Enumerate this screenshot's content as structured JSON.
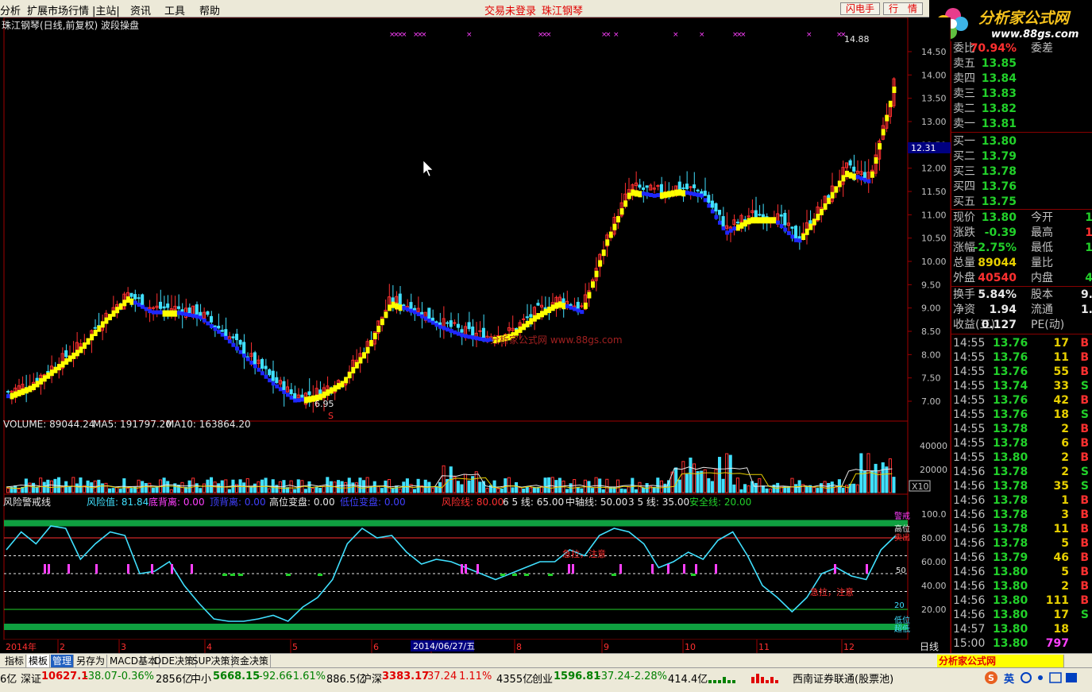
{
  "menu": {
    "items": [
      "分析",
      "扩展市场行情",
      "|主站|",
      "资讯",
      "工具",
      "帮助"
    ],
    "trade": "交易未登录",
    "stock": "珠江钢琴",
    "flash": "闪电手",
    "hq": "行　情"
  },
  "logo": {
    "title": "分析家公式网",
    "url": "www.88gs.com"
  },
  "chart": {
    "title": "珠江钢琴(日线,前复权) 波段操盘",
    "high_label": "14.88",
    "low_label": "6.95",
    "s_mark": "S",
    "crosshair_price": "12.31",
    "watermark": "分析家公式网 www.88gs.com",
    "date_marker": "2014/06/27/五",
    "year_label": "2014年",
    "month_labels": [
      "2",
      "3",
      "4",
      "5",
      "6",
      "7",
      "8",
      "9",
      "10",
      "11",
      "12"
    ],
    "period": "日线",
    "price_ticks": [
      "14.50",
      "14.00",
      "13.50",
      "13.00",
      "12.50",
      "12.00",
      "11.50",
      "11.00",
      "10.50",
      "10.00",
      "9.50",
      "9.00",
      "8.50",
      "8.00",
      "7.50",
      "7.00"
    ]
  },
  "volume": {
    "label": "VOLUME: 89044.24",
    "ma5": "MA5: 191797.20",
    "ma10": "MA10: 163864.20",
    "ticks": [
      "40000",
      "20000"
    ],
    "unit": "X10"
  },
  "risk": {
    "name": "风险警戒线",
    "fxz": "风险值: 81.84",
    "dbl": "底背离: 0.00",
    "dbl2": "顶背离: 0.00",
    "gwbp": "高位变盘: 0.00",
    "dwbp": "低位变盘: 0.00",
    "fxx": "风险线: 80.00",
    "x65": "6 5 线: 65.00",
    "zzx": "中轴线: 50.00",
    "x35": "3 5 线: 35.00",
    "aqx": "安全线: 20.00",
    "ticks": [
      "100.0",
      "80.00",
      "60.00",
      "40.00",
      "20.00"
    ],
    "mid": "50",
    "notes": [
      "急拉，注意",
      "急拉，注意"
    ],
    "side": [
      "警戒",
      "高位",
      "卖出",
      "20",
      "低位",
      "超低"
    ]
  },
  "chart_data": {
    "type": "line",
    "close_estimates": [
      7.2,
      7.4,
      7.8,
      8.2,
      8.8,
      9.3,
      9.0,
      9.0,
      8.9,
      8.5,
      8.0,
      7.5,
      7.1,
      7.2,
      7.5,
      8.2,
      9.2,
      9.0,
      8.7,
      8.5,
      8.4,
      8.5,
      8.9,
      9.2,
      9.0,
      10.5,
      11.6,
      11.5,
      11.6,
      11.5,
      10.7,
      11.0,
      11.0,
      10.5,
      11.2,
      12.0,
      11.8,
      13.8
    ]
  },
  "quote": {
    "ratio": {
      "label": "委比",
      "value": "70.94%",
      "label2": "委差",
      "value2": ""
    },
    "asks": [
      {
        "label": "卖五",
        "price": "13.85",
        "vol": ""
      },
      {
        "label": "卖四",
        "price": "13.84",
        "vol": ""
      },
      {
        "label": "卖三",
        "price": "13.83",
        "vol": ""
      },
      {
        "label": "卖二",
        "price": "13.82",
        "vol": ""
      },
      {
        "label": "卖一",
        "price": "13.81",
        "vol": ""
      }
    ],
    "bids": [
      {
        "label": "买一",
        "price": "13.80",
        "vol": ""
      },
      {
        "label": "买二",
        "price": "13.79",
        "vol": ""
      },
      {
        "label": "买三",
        "price": "13.78",
        "vol": ""
      },
      {
        "label": "买四",
        "price": "13.76",
        "vol": ""
      },
      {
        "label": "买五",
        "price": "13.75",
        "vol": ""
      }
    ],
    "info": [
      {
        "l1": "现价",
        "v1": "13.80",
        "c1": "#22d02a",
        "l2": "今开",
        "v2": "1",
        "c2": "#22d02a"
      },
      {
        "l1": "涨跌",
        "v1": "-0.39",
        "c1": "#22d02a",
        "l2": "最高",
        "v2": "1",
        "c2": "#ff3030"
      },
      {
        "l1": "涨幅",
        "v1": "-2.75%",
        "c1": "#22d02a",
        "l2": "最低",
        "v2": "1",
        "c2": "#22d02a"
      },
      {
        "l1": "总量",
        "v1": "89044",
        "c1": "#e8d000",
        "l2": "量比",
        "v2": "",
        "c2": "#e8d000"
      },
      {
        "l1": "外盘",
        "v1": "40540",
        "c1": "#ff3030",
        "l2": "内盘",
        "v2": "4",
        "c2": "#22d02a"
      },
      {
        "l1": "换手",
        "v1": "5.84%",
        "c1": "#e8e8e8",
        "l2": "股本",
        "v2": "9.",
        "c2": "#e8e8e8"
      },
      {
        "l1": "净资",
        "v1": "1.94",
        "c1": "#e8e8e8",
        "l2": "流通",
        "v2": "1.",
        "c2": "#e8e8e8"
      },
      {
        "l1": "收益(三)",
        "v1": "0.127",
        "c1": "#e8e8e8",
        "l2": "PE(动)",
        "v2": "",
        "c2": "#e8e8e8"
      }
    ],
    "ticks": [
      {
        "t": "14:55",
        "p": "13.76",
        "v": "17",
        "b": "B"
      },
      {
        "t": "14:55",
        "p": "13.76",
        "v": "11",
        "b": "B"
      },
      {
        "t": "14:55",
        "p": "13.76",
        "v": "55",
        "b": "B"
      },
      {
        "t": "14:55",
        "p": "13.74",
        "v": "33",
        "b": "S"
      },
      {
        "t": "14:55",
        "p": "13.76",
        "v": "42",
        "b": "B"
      },
      {
        "t": "14:55",
        "p": "13.76",
        "v": "18",
        "b": "S"
      },
      {
        "t": "14:55",
        "p": "13.78",
        "v": "2",
        "b": "B"
      },
      {
        "t": "14:55",
        "p": "13.78",
        "v": "6",
        "b": "B"
      },
      {
        "t": "14:55",
        "p": "13.80",
        "v": "2",
        "b": "B"
      },
      {
        "t": "14:56",
        "p": "13.78",
        "v": "2",
        "b": "S"
      },
      {
        "t": "14:56",
        "p": "13.78",
        "v": "35",
        "b": "S"
      },
      {
        "t": "14:56",
        "p": "13.78",
        "v": "1",
        "b": "B"
      },
      {
        "t": "14:56",
        "p": "13.78",
        "v": "3",
        "b": "B"
      },
      {
        "t": "14:56",
        "p": "13.78",
        "v": "11",
        "b": "B"
      },
      {
        "t": "14:56",
        "p": "13.78",
        "v": "5",
        "b": "B"
      },
      {
        "t": "14:56",
        "p": "13.79",
        "v": "46",
        "b": "B"
      },
      {
        "t": "14:56",
        "p": "13.80",
        "v": "5",
        "b": "B"
      },
      {
        "t": "14:56",
        "p": "13.80",
        "v": "2",
        "b": "B"
      },
      {
        "t": "14:56",
        "p": "13.80",
        "v": "111",
        "b": "B"
      },
      {
        "t": "14:56",
        "p": "13.80",
        "v": "17",
        "b": "S"
      },
      {
        "t": "14:57",
        "p": "13.80",
        "v": "18",
        "b": ""
      },
      {
        "t": "15:00",
        "p": "13.80",
        "v": "797",
        "b": ""
      }
    ]
  },
  "tabs": [
    "指标",
    "模板",
    "管理",
    "另存为",
    "MACD基本",
    "DDE决策",
    "SUP决策",
    "资金决策"
  ],
  "status": {
    "s0": "6亿",
    "sz": "深证",
    "szv": "10627.1",
    "szc": "-38.07",
    "szp": "-0.36%",
    "sza": "2856亿",
    "zx": "中小",
    "zxv": "5668.15",
    "zxc": "-92.66",
    "zxp": "-1.61%",
    "zxa": "886.5亿",
    "sh": "沪深",
    "shv": "3383.17",
    "shc": "37.24",
    "shp": "1.11%",
    "sha": "4355亿",
    "cy": "创业",
    "cyv": "1596.81",
    "cyc": "-37.24",
    "cyp": "-2.28%",
    "cya": "414.4亿",
    "broker": "西南证券联通(股票池)",
    "ime": "英"
  }
}
